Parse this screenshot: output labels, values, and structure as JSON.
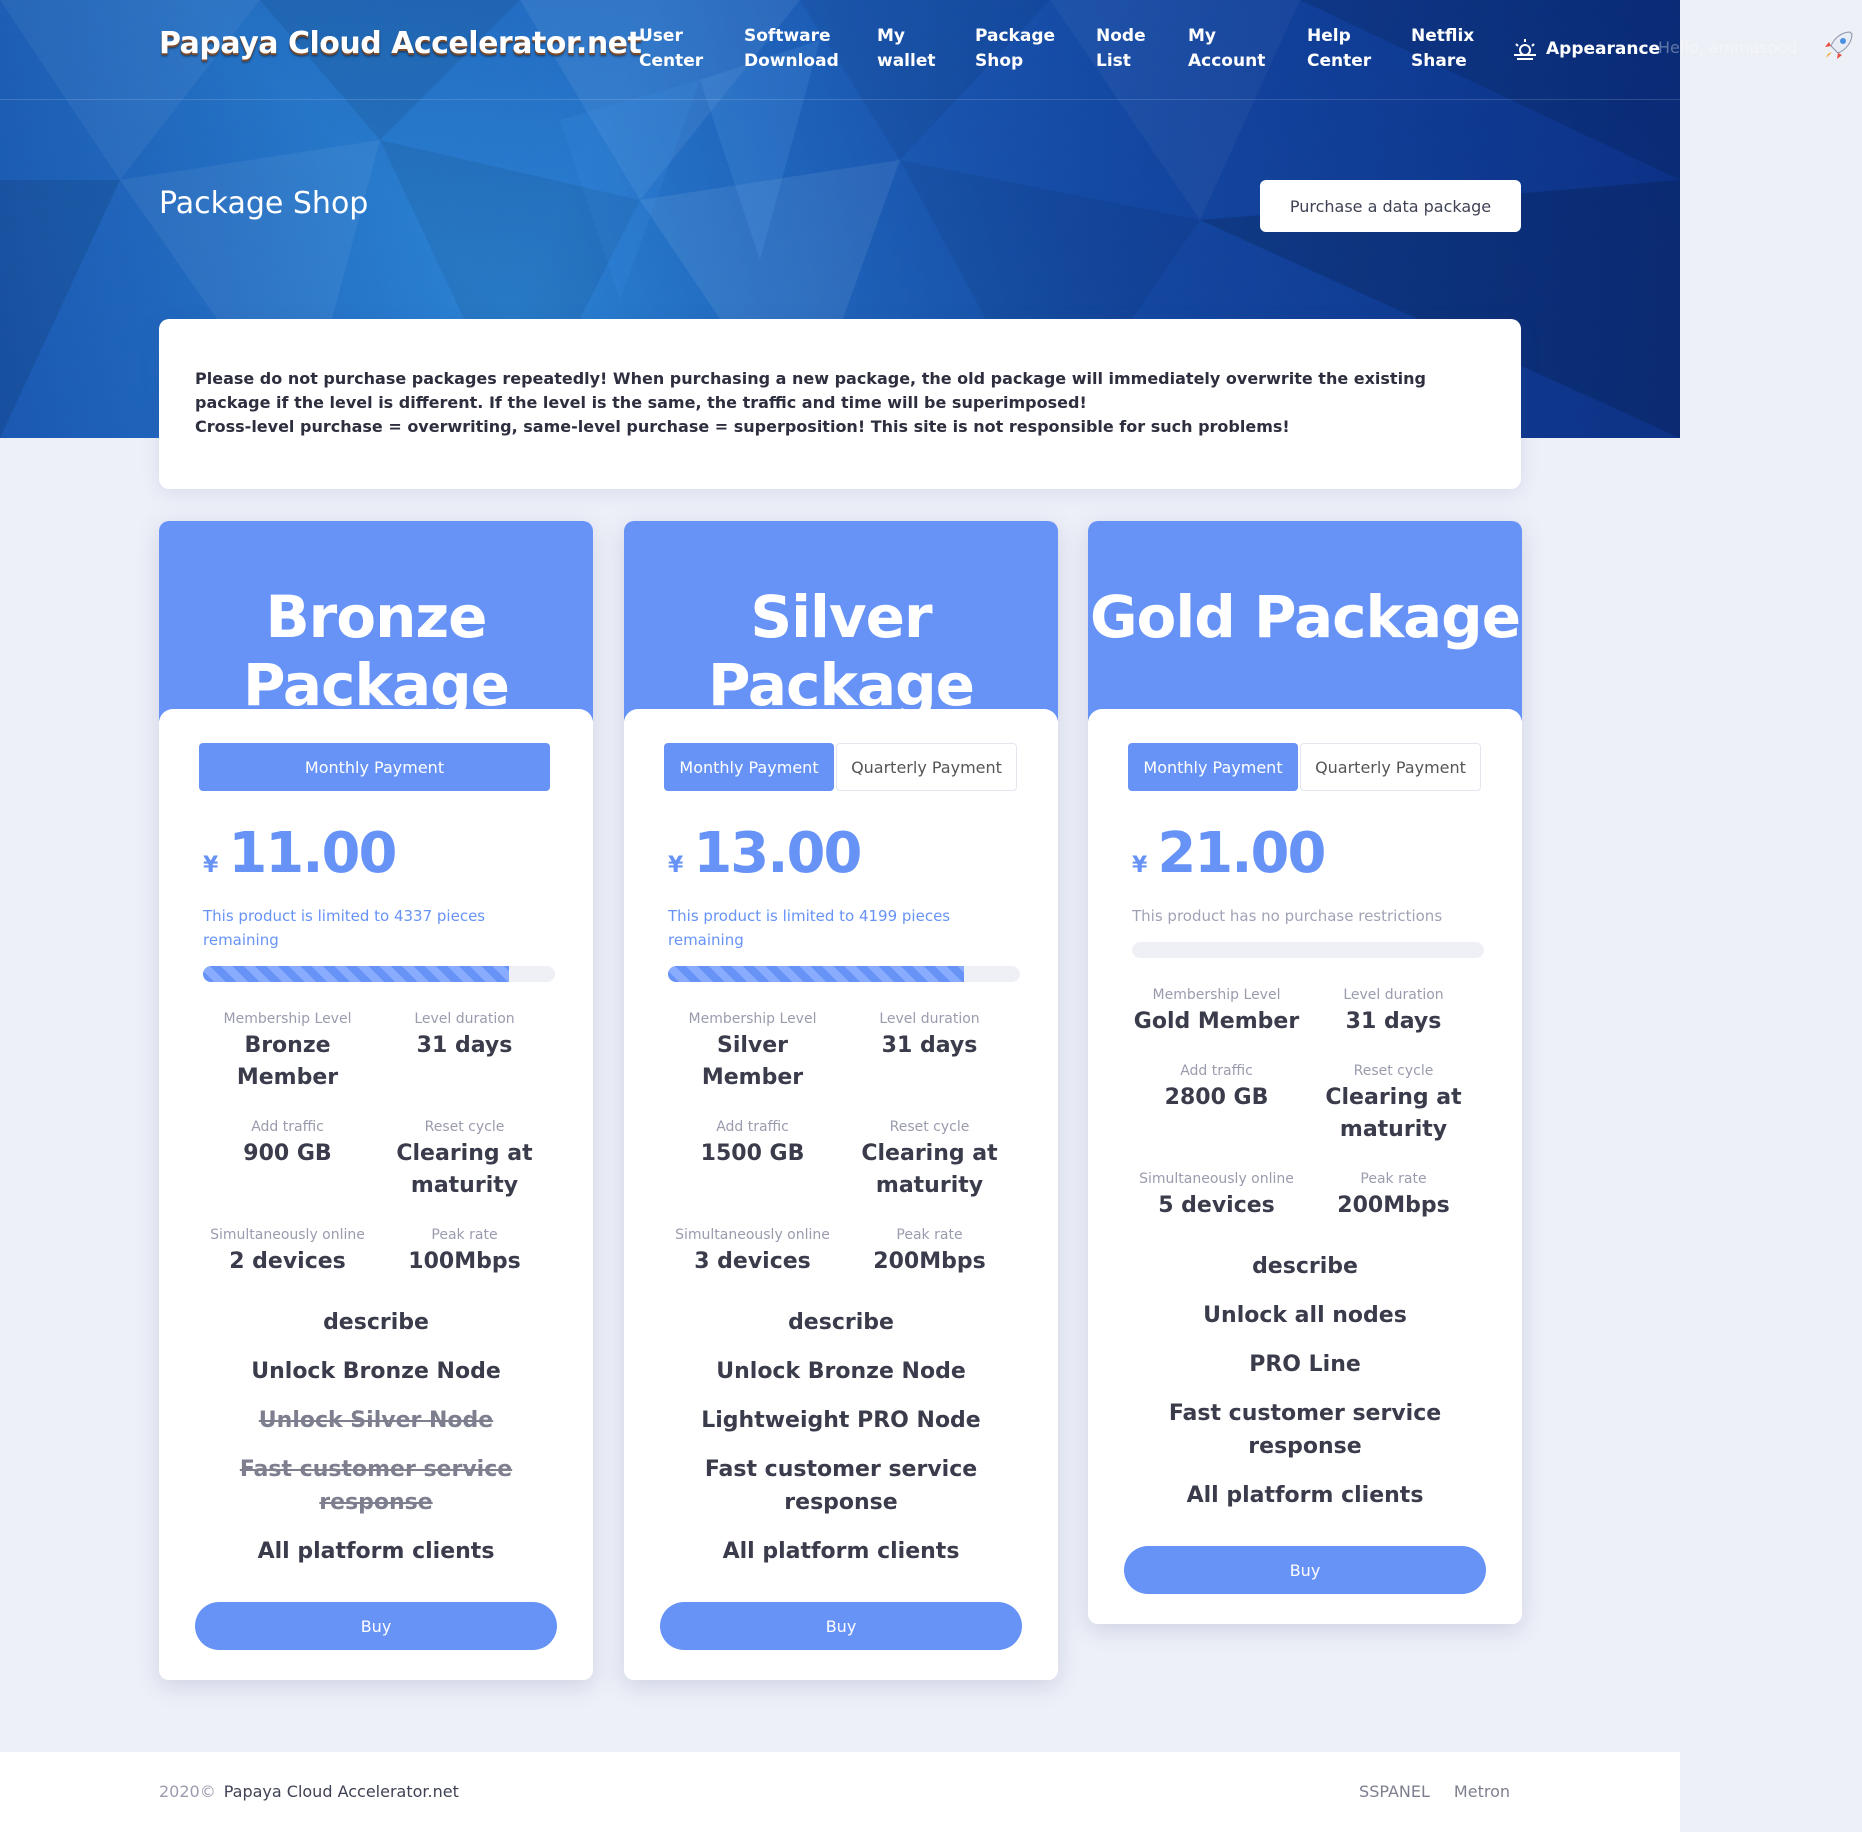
{
  "brand": "Papaya Cloud Accelerator.net",
  "nav": [
    {
      "line1": "User",
      "line2": "Center"
    },
    {
      "line1": "Software",
      "line2": "Download"
    },
    {
      "line1": "My",
      "line2": "wallet"
    },
    {
      "line1": "Package",
      "line2": "Shop"
    },
    {
      "line1": "Node",
      "line2": "List"
    },
    {
      "line1": "My",
      "line2": "Account"
    },
    {
      "line1": "Help",
      "line2": "Center"
    },
    {
      "line1": "Netflix",
      "line2": "Share"
    }
  ],
  "appearance_label": "Appearance",
  "greeting": "Hello, ammasood",
  "page_title": "Package Shop",
  "purchase_button": "Purchase a data package",
  "notice": {
    "line1": "Please do not purchase packages repeatedly! When purchasing a new package, the old package will immediately overwrite the existing package if the level is different. If the level is the same, the traffic and time will be superimposed!",
    "line2": "Cross-level purchase = overwriting, same-level purchase = superposition! This site is not responsible for such problems!"
  },
  "currency": "¥",
  "labels": {
    "membership_level": "Membership Level",
    "level_duration": "Level duration",
    "add_traffic": "Add traffic",
    "reset_cycle": "Reset cycle",
    "simultaneously_online": "Simultaneously online",
    "peak_rate": "Peak rate",
    "describe": "describe",
    "buy": "Buy",
    "monthly": "Monthly Payment",
    "quarterly": "Quarterly Payment"
  },
  "packages": [
    {
      "title": "Bronze Package",
      "price": "11.00",
      "limit_text": "This product is limited to 4337 pieces remaining",
      "remaining_fraction": 0.87,
      "level": "Bronze Member",
      "duration": "31 days",
      "traffic": "900 GB",
      "reset": "Clearing at maturity",
      "online": "2 devices",
      "rate": "100Mbps",
      "features": [
        {
          "text": "Unlock Bronze Node",
          "enabled": true
        },
        {
          "text": "Unlock Silver Node",
          "enabled": false
        },
        {
          "text": "Fast customer service response",
          "enabled": false
        },
        {
          "text": "All platform clients",
          "enabled": true
        }
      ]
    },
    {
      "title": "Silver Package",
      "price": "13.00",
      "limit_text": "This product is limited to 4199 pieces remaining",
      "remaining_fraction": 0.84,
      "level": "Silver Member",
      "duration": "31 days",
      "traffic": "1500 GB",
      "reset": "Clearing at maturity",
      "online": "3 devices",
      "rate": "200Mbps",
      "features": [
        {
          "text": "Unlock Bronze Node",
          "enabled": true
        },
        {
          "text": "Lightweight PRO Node",
          "enabled": true
        },
        {
          "text": "Fast customer service response",
          "enabled": true
        },
        {
          "text": "All platform clients",
          "enabled": true
        }
      ]
    },
    {
      "title": "Gold Package",
      "price": "21.00",
      "limit_text": "This product has no purchase restrictions",
      "remaining_fraction": 0,
      "level": "Gold Member",
      "duration": "31 days",
      "traffic": "2800 GB",
      "reset": "Clearing at maturity",
      "online": "5 devices",
      "rate": "200Mbps",
      "features": [
        {
          "text": "Unlock all nodes",
          "enabled": true
        },
        {
          "text": "PRO Line",
          "enabled": true
        },
        {
          "text": "Fast customer service response",
          "enabled": true
        },
        {
          "text": "All platform clients",
          "enabled": true
        }
      ]
    }
  ],
  "footer": {
    "year": "2020©",
    "site": "Papaya Cloud Accelerator.net",
    "link1": "SSPANEL",
    "link2": "Metron"
  },
  "colors": {
    "accent": "#6793f7",
    "hero_dark": "#0d3a96",
    "hero_light": "#2d8ad6"
  }
}
